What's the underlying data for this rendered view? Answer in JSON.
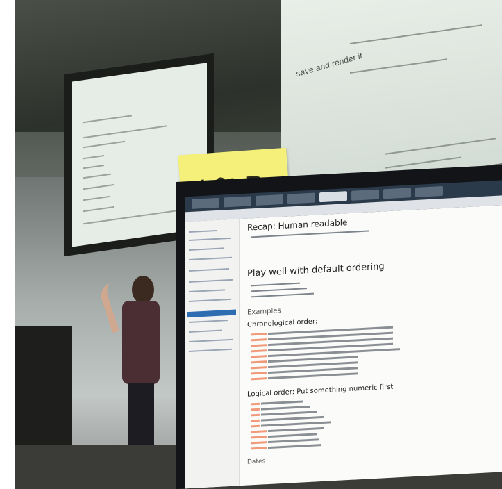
{
  "sticky_note": {
    "text_left": "I",
    "text_right": "R",
    "heart": "♥"
  },
  "slide_right": {
    "heading": "save and render it"
  },
  "monitor": {
    "heading_1": "Recap: Human readable",
    "heading_2": "Play well with default ordering",
    "heading_3": "Examples",
    "heading_4": "Chronological order:",
    "heading_5": "Logical order: Put something numeric first",
    "heading_6": "Dates"
  },
  "colors": {
    "sticky": "#f4f07a",
    "highlight": "#f19a7a",
    "active_nav": "#2f6db3"
  }
}
